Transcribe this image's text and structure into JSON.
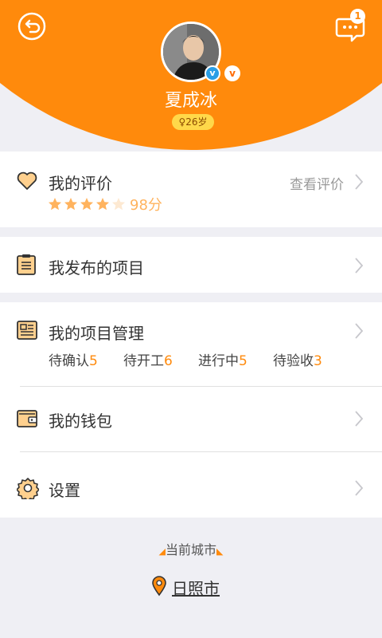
{
  "header": {
    "user_name": "夏成冰",
    "age_tag": "26岁",
    "message_count": "1",
    "badge_blue": "v",
    "badge_orange": "v"
  },
  "reviews": {
    "label": "我的评价",
    "rating_stars": 4,
    "max_stars": 5,
    "score": "98分",
    "view_link": "查看评价"
  },
  "published": {
    "label": "我发布的项目"
  },
  "management": {
    "label": "我的项目管理",
    "stats": [
      {
        "label": "待确认",
        "count": "5"
      },
      {
        "label": "待开工",
        "count": "6"
      },
      {
        "label": "进行中",
        "count": "5"
      },
      {
        "label": "待验收",
        "count": "3"
      }
    ]
  },
  "wallet": {
    "label": "我的钱包"
  },
  "settings": {
    "label": "设置"
  },
  "city": {
    "caption": "当前城市",
    "name": "日照市"
  },
  "colors": {
    "accent": "#ff8a0c",
    "star": "#ffb35e",
    "age_tag": "#ffd84a",
    "verified_blue": "#2a9ee6"
  }
}
